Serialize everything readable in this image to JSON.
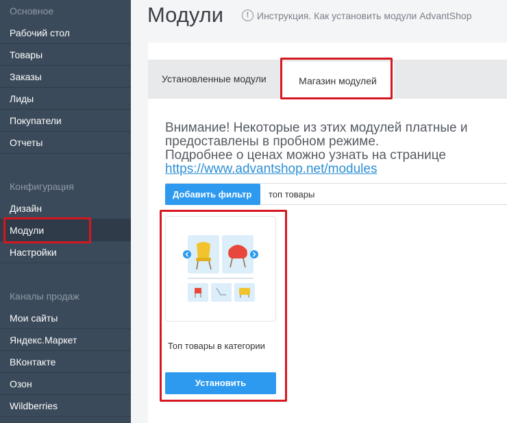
{
  "sidebar": {
    "section_main": "Основное",
    "main_items": [
      "Рабочий стол",
      "Товары",
      "Заказы",
      "Лиды",
      "Покупатели",
      "Отчеты"
    ],
    "section_config": "Конфигурация",
    "config_items": [
      "Дизайн",
      "Модули",
      "Настройки"
    ],
    "section_channels": "Каналы продаж",
    "channel_items": [
      "Мои сайты",
      "Яндекс.Маркет",
      "ВКонтакте",
      "Озон",
      "Wildberries"
    ],
    "active_item": "Модули"
  },
  "header": {
    "title": "Модули",
    "help_link": "Инструкция. Как установить модули AdvantShop"
  },
  "tabs": {
    "installed": "Установленные модули",
    "store": "Магазин модулей",
    "active": "store"
  },
  "notice": {
    "line1": "Внимание! Некоторые из этих модулей платные и предоставлены в пробном режиме.",
    "line2": "Подробнее о ценах можно узнать на странице",
    "link": "https://www.advantshop.net/modules"
  },
  "filter": {
    "button_label": "Добавить фильтр",
    "query": "топ товары"
  },
  "module_card": {
    "title": "Топ товары в категории",
    "install_label": "Установить"
  },
  "colors": {
    "sidebar_bg": "#3b4a5a",
    "accent_blue": "#2d9af0",
    "highlight_red": "#d6171f"
  }
}
